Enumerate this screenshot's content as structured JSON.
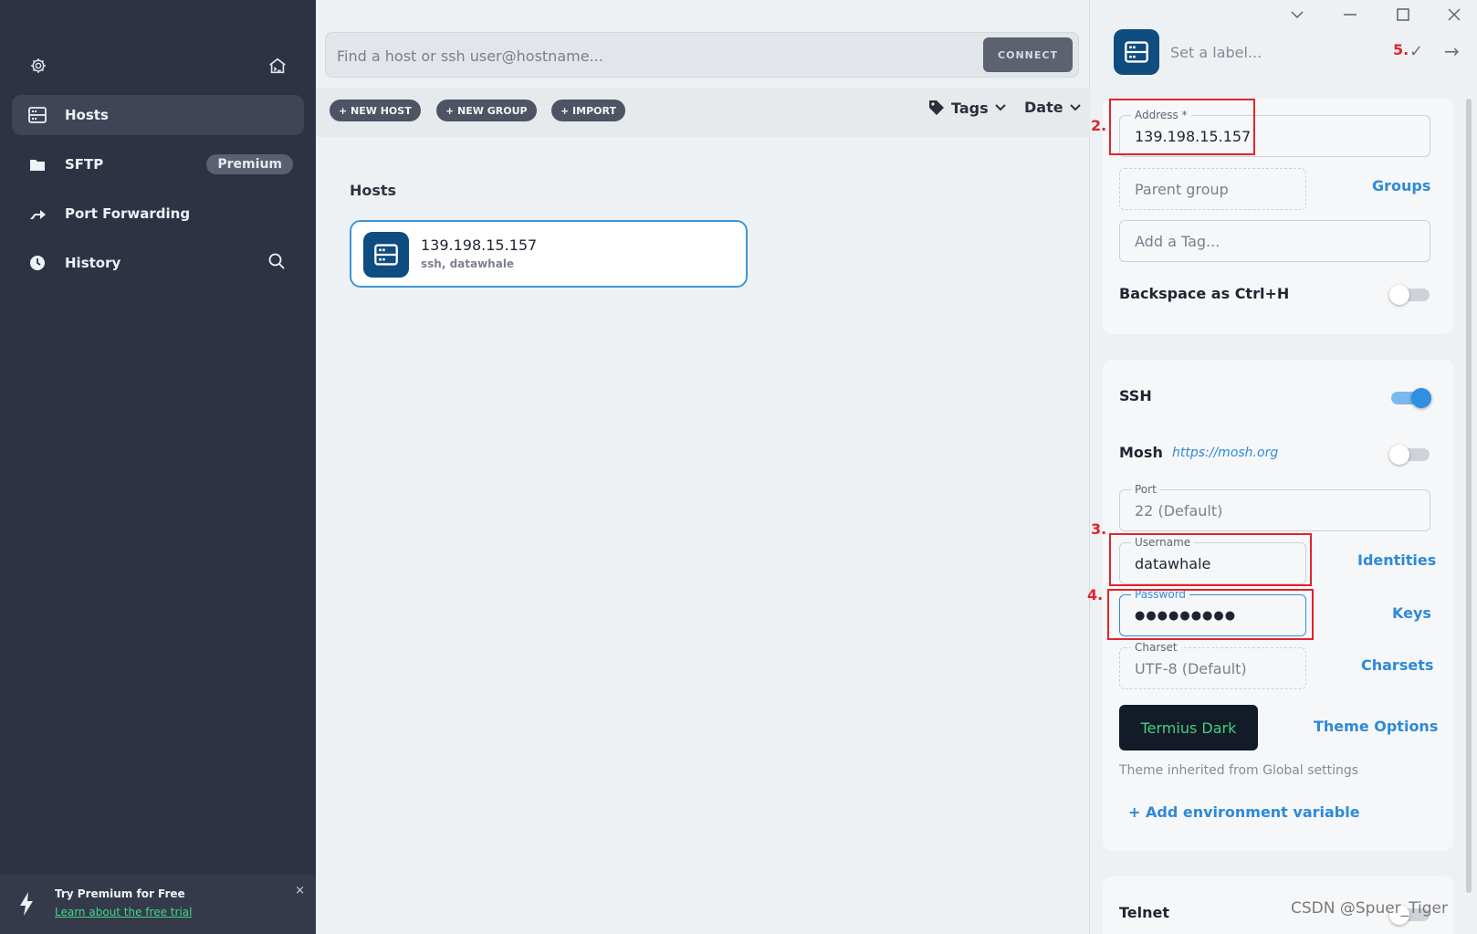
{
  "sidebar": {
    "items": [
      {
        "label": "Hosts"
      },
      {
        "label": "SFTP",
        "badge": "Premium"
      },
      {
        "label": "Port Forwarding"
      },
      {
        "label": "History"
      }
    ],
    "promo": {
      "title": "Try Premium for Free",
      "link": "Learn about the free trial",
      "close": "×"
    }
  },
  "main": {
    "search_placeholder": "Find a host or ssh user@hostname...",
    "connect_label": "CONNECT",
    "toolbar": {
      "new_host": "+ NEW HOST",
      "new_group": "+ NEW GROUP",
      "import": "+ IMPORT",
      "tags": "Tags",
      "date": "Date"
    },
    "section_title": "Hosts",
    "hosts": [
      {
        "name": "139.198.15.157",
        "sub": "ssh, datawhale"
      }
    ]
  },
  "panel": {
    "label_placeholder": "Set a label...",
    "address": {
      "label": "Address *",
      "value": "139.198.15.157"
    },
    "parent_group_placeholder": "Parent group",
    "groups_link": "Groups",
    "tag_placeholder": "Add a Tag...",
    "backspace_label": "Backspace as Ctrl+H",
    "ssh_label": "SSH",
    "mosh_label": "Mosh",
    "mosh_link": "https://mosh.org",
    "port": {
      "label": "Port",
      "value": "22 (Default)"
    },
    "username": {
      "label": "Username",
      "value": "datawhale"
    },
    "identities_link": "Identities",
    "password": {
      "label": "Password",
      "value": "●●●●●●●●●"
    },
    "keys_link": "Keys",
    "charset": {
      "label": "Charset",
      "value": "UTF-8 (Default)"
    },
    "charsets_link": "Charsets",
    "theme_button": "Termius Dark",
    "theme_options_link": "Theme Options",
    "theme_hint": "Theme inherited from Global settings",
    "add_env": "+ Add environment variable",
    "telnet_label": "Telnet"
  },
  "annotations": {
    "step2": "2.",
    "step3": "3.",
    "step4": "4.",
    "step5": "5."
  },
  "watermark": "CSDN @Spuer_Tiger",
  "colors": {
    "sidebar": "#2e3344",
    "accent": "#2f8fe0",
    "host_icon": "#0f4c80",
    "annotation": "#e0242b",
    "theme_text": "#3ed47c"
  }
}
